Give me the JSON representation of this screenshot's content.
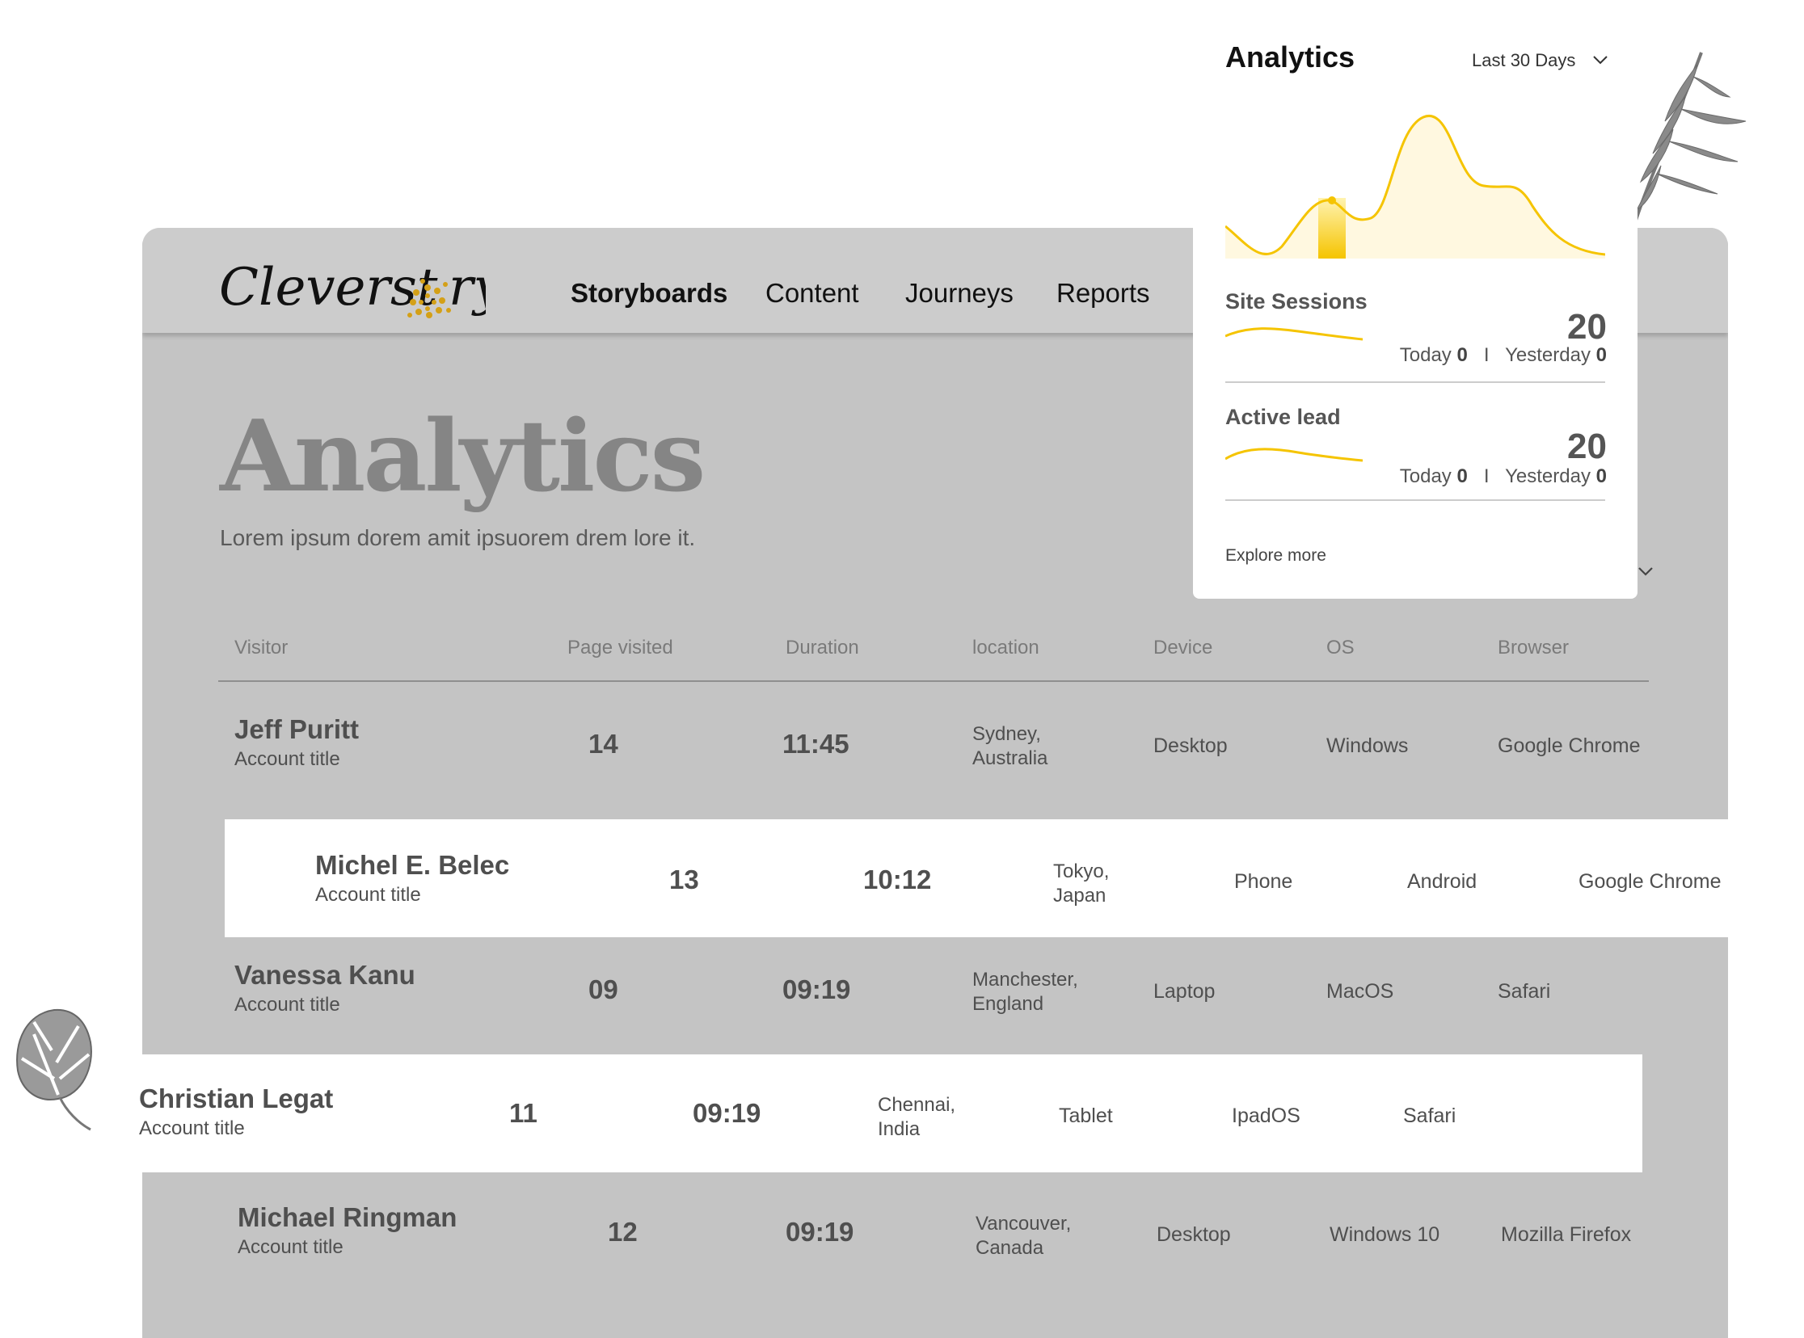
{
  "brand": {
    "logo_text": "Cleverstory",
    "accent_color": "#f5c400"
  },
  "nav": {
    "items": [
      {
        "label": "Storyboards",
        "active": true
      },
      {
        "label": "Content",
        "active": false
      },
      {
        "label": "Journeys",
        "active": false
      },
      {
        "label": "Reports",
        "active": false
      }
    ]
  },
  "page": {
    "title": "Analytics",
    "subtitle": "Lorem ipsum dorem amit ipsuorem drem lore it."
  },
  "table": {
    "columns": [
      "Visitor",
      "Page visited",
      "Duration",
      "location",
      "Device",
      "OS",
      "Browser"
    ],
    "rows": [
      {
        "name": "Jeff Puritt",
        "account": "Account title",
        "pages": "14",
        "duration": "11:45",
        "location": "Sydney,\nAustralia",
        "device": "Desktop",
        "os": "Windows",
        "browser": "Google Chrome"
      },
      {
        "name": "Michel E. Belec",
        "account": "Account title",
        "pages": "13",
        "duration": "10:12",
        "location": "Tokyo,\nJapan",
        "device": "Phone",
        "os": "Android",
        "browser": "Google Chrome"
      },
      {
        "name": "Vanessa Kanu",
        "account": "Account title",
        "pages": "09",
        "duration": "09:19",
        "location": "Manchester,\nEngland",
        "device": "Laptop",
        "os": "MacOS",
        "browser": "Safari"
      },
      {
        "name": "Christian Legat",
        "account": "Account title",
        "pages": "11",
        "duration": "09:19",
        "location": "Chennai,\nIndia",
        "device": "Tablet",
        "os": "IpadOS",
        "browser": "Safari"
      },
      {
        "name": "Michael Ringman",
        "account": "Account title",
        "pages": "12",
        "duration": "09:19",
        "location": "Vancouver,\nCanada",
        "device": "Desktop",
        "os": "Windows 10",
        "browser": "Mozilla Firefox"
      }
    ]
  },
  "analytics_card": {
    "title": "Analytics",
    "range": "Last 30 Days",
    "metrics": [
      {
        "label": "Site Sessions",
        "value": "20",
        "today_label": "Today",
        "today_value": "0",
        "separator": "I",
        "yesterday_label": "Yesterday",
        "yesterday_value": "0"
      },
      {
        "label": "Active lead",
        "value": "20",
        "today_label": "Today",
        "today_value": "0",
        "separator": "I",
        "yesterday_label": "Yesterday",
        "yesterday_value": "0"
      }
    ],
    "explore_label": "Explore more"
  },
  "icons": {
    "range_dropdown": "chevron-down-icon",
    "panel_collapse": "chevron-down-icon",
    "decor_top_right": "palm-leaf-icon",
    "decor_left": "monstera-leaf-icon"
  }
}
